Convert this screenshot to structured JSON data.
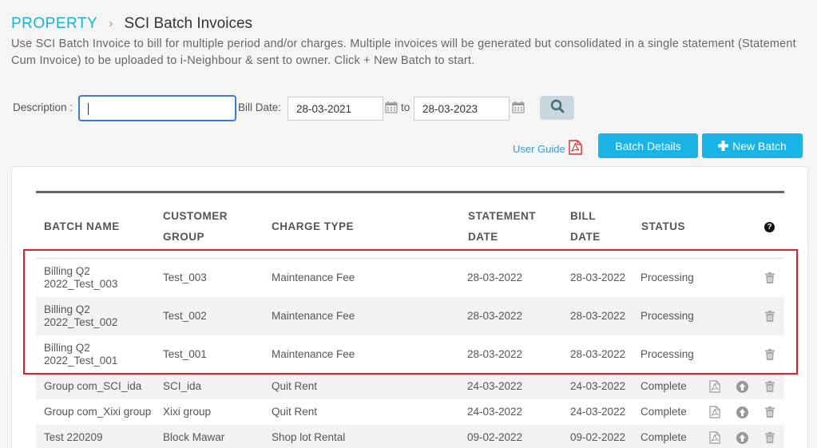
{
  "breadcrumb": {
    "root": "PROPERTY",
    "separator": "›",
    "page": "SCI Batch Invoices"
  },
  "description": "Use SCI Batch Invoice to bill for multiple period and/or charges. Multiple invoices will be generated but consolidated in a single statement (Statement Cum Invoice) to be uploaded to i-Neighbour & sent to owner. Click + New Batch to start.",
  "filters": {
    "description_label": "Description :",
    "description_value": "",
    "bill_date_label": "Bill Date:",
    "from_date": "28-03-2021",
    "to_label": "to",
    "to_date": "28-03-2023"
  },
  "actions": {
    "user_guide": "User Guide",
    "batch_details": "Batch Details",
    "new_batch": "New Batch"
  },
  "table": {
    "headers": {
      "batch_name": "BATCH NAME",
      "customer_group_1": "CUSTOMER",
      "customer_group_2": "GROUP",
      "charge_type": "CHARGE TYPE",
      "statement_date_1": "STATEMENT",
      "statement_date_2": "DATE",
      "bill_date_1": "BILL",
      "bill_date_2": "DATE",
      "status": "STATUS",
      "help": "?"
    },
    "rows": [
      {
        "batch_name_1": "Billing Q2",
        "batch_name_2": "2022_Test_003",
        "customer_group": "Test_003",
        "charge_type": "Maintenance Fee",
        "statement_date": "28-03-2022",
        "bill_date": "28-03-2022",
        "status": "Processing"
      },
      {
        "batch_name_1": "Billing Q2",
        "batch_name_2": "2022_Test_002",
        "customer_group": "Test_002",
        "charge_type": "Maintenance Fee",
        "statement_date": "28-03-2022",
        "bill_date": "28-03-2022",
        "status": "Processing"
      },
      {
        "batch_name_1": "Billing Q2",
        "batch_name_2": "2022_Test_001",
        "customer_group": "Test_001",
        "charge_type": "Maintenance Fee",
        "statement_date": "28-03-2022",
        "bill_date": "28-03-2022",
        "status": "Processing"
      },
      {
        "batch_name_1": "Group com_SCI_ida",
        "customer_group": "SCI_ida",
        "charge_type": "Quit Rent",
        "statement_date": "24-03-2022",
        "bill_date": "24-03-2022",
        "status": "Complete"
      },
      {
        "batch_name_1": "Group com_Xixi group",
        "customer_group": "Xixi group",
        "charge_type": "Quit Rent",
        "statement_date": "24-03-2022",
        "bill_date": "24-03-2022",
        "status": "Complete"
      },
      {
        "batch_name_1": "Test 220209",
        "customer_group": "Block Mawar",
        "charge_type": "Shop lot Rental",
        "statement_date": "09-02-2022",
        "bill_date": "09-02-2022",
        "status": "Complete"
      }
    ]
  }
}
